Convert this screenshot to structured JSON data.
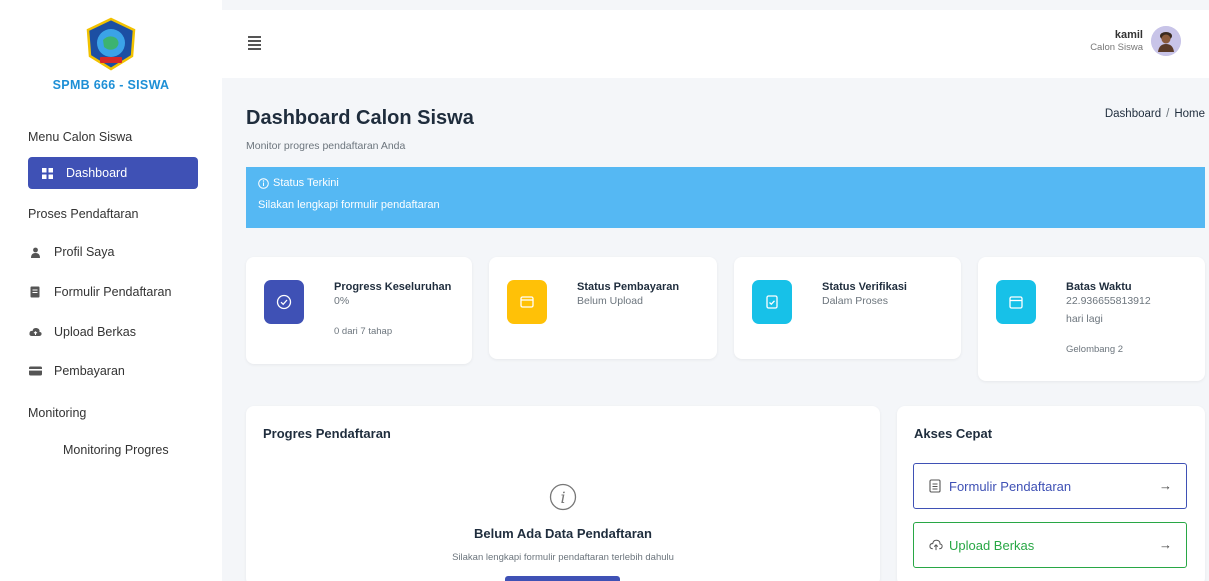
{
  "brand": {
    "name": "SPMB 666 - SISWA"
  },
  "sidebar": {
    "menu_heading": "Menu Calon Siswa",
    "dashboard": "Dashboard",
    "proses_heading": "Proses Pendaftaran",
    "items": [
      {
        "label": "Profil Saya",
        "icon": "user-icon"
      },
      {
        "label": "Formulir Pendaftaran",
        "icon": "document-icon"
      },
      {
        "label": "Upload Berkas",
        "icon": "cloud-upload-icon"
      },
      {
        "label": "Pembayaran",
        "icon": "card-icon"
      }
    ],
    "monitoring_heading": "Monitoring",
    "monitoring_item": "Monitoring Progres"
  },
  "user": {
    "name": "kamil",
    "role": "Calon Siswa"
  },
  "page": {
    "title": "Dashboard Calon Siswa",
    "subtitle": "Monitor progres pendaftaran Anda"
  },
  "breadcrumb": {
    "items": [
      "Dashboard",
      "Home"
    ],
    "separator": "/"
  },
  "alert": {
    "title": "Status Terkini",
    "message": "Silakan lengkapi formulir pendaftaran",
    "color": "#55b8f3"
  },
  "stats": [
    {
      "title": "Progress Keseluruhan",
      "value": "0%",
      "footer": "0 dari 7 tahap",
      "color": "#3f51b5",
      "icon": "check-circle-icon"
    },
    {
      "title": "Status Pembayaran",
      "value": "Belum Upload",
      "color": "#ffc107",
      "icon": "wallet-icon"
    },
    {
      "title": "Status Verifikasi",
      "value": "Dalam Proses",
      "color": "#17c1e8",
      "icon": "clipboard-check-icon"
    },
    {
      "title": "Batas Waktu",
      "value": "22.936655813912",
      "value2": "hari lagi",
      "footer": "Gelombang 2",
      "color": "#17c1e8",
      "icon": "calendar-icon"
    }
  ],
  "progress": {
    "title": "Progres Pendaftaran",
    "empty_title": "Belum Ada Data Pendaftaran",
    "empty_sub": "Silakan lengkapi formulir pendaftaran terlebih dahulu"
  },
  "quick": {
    "title": "Akses Cepat",
    "buttons": [
      {
        "label": "Formulir Pendaftaran",
        "color": "#3f51b5",
        "icon": "document-icon",
        "arrow": "→"
      },
      {
        "label": "Upload Berkas",
        "color": "#28a745",
        "icon": "cloud-upload-icon",
        "arrow": "→"
      }
    ]
  }
}
